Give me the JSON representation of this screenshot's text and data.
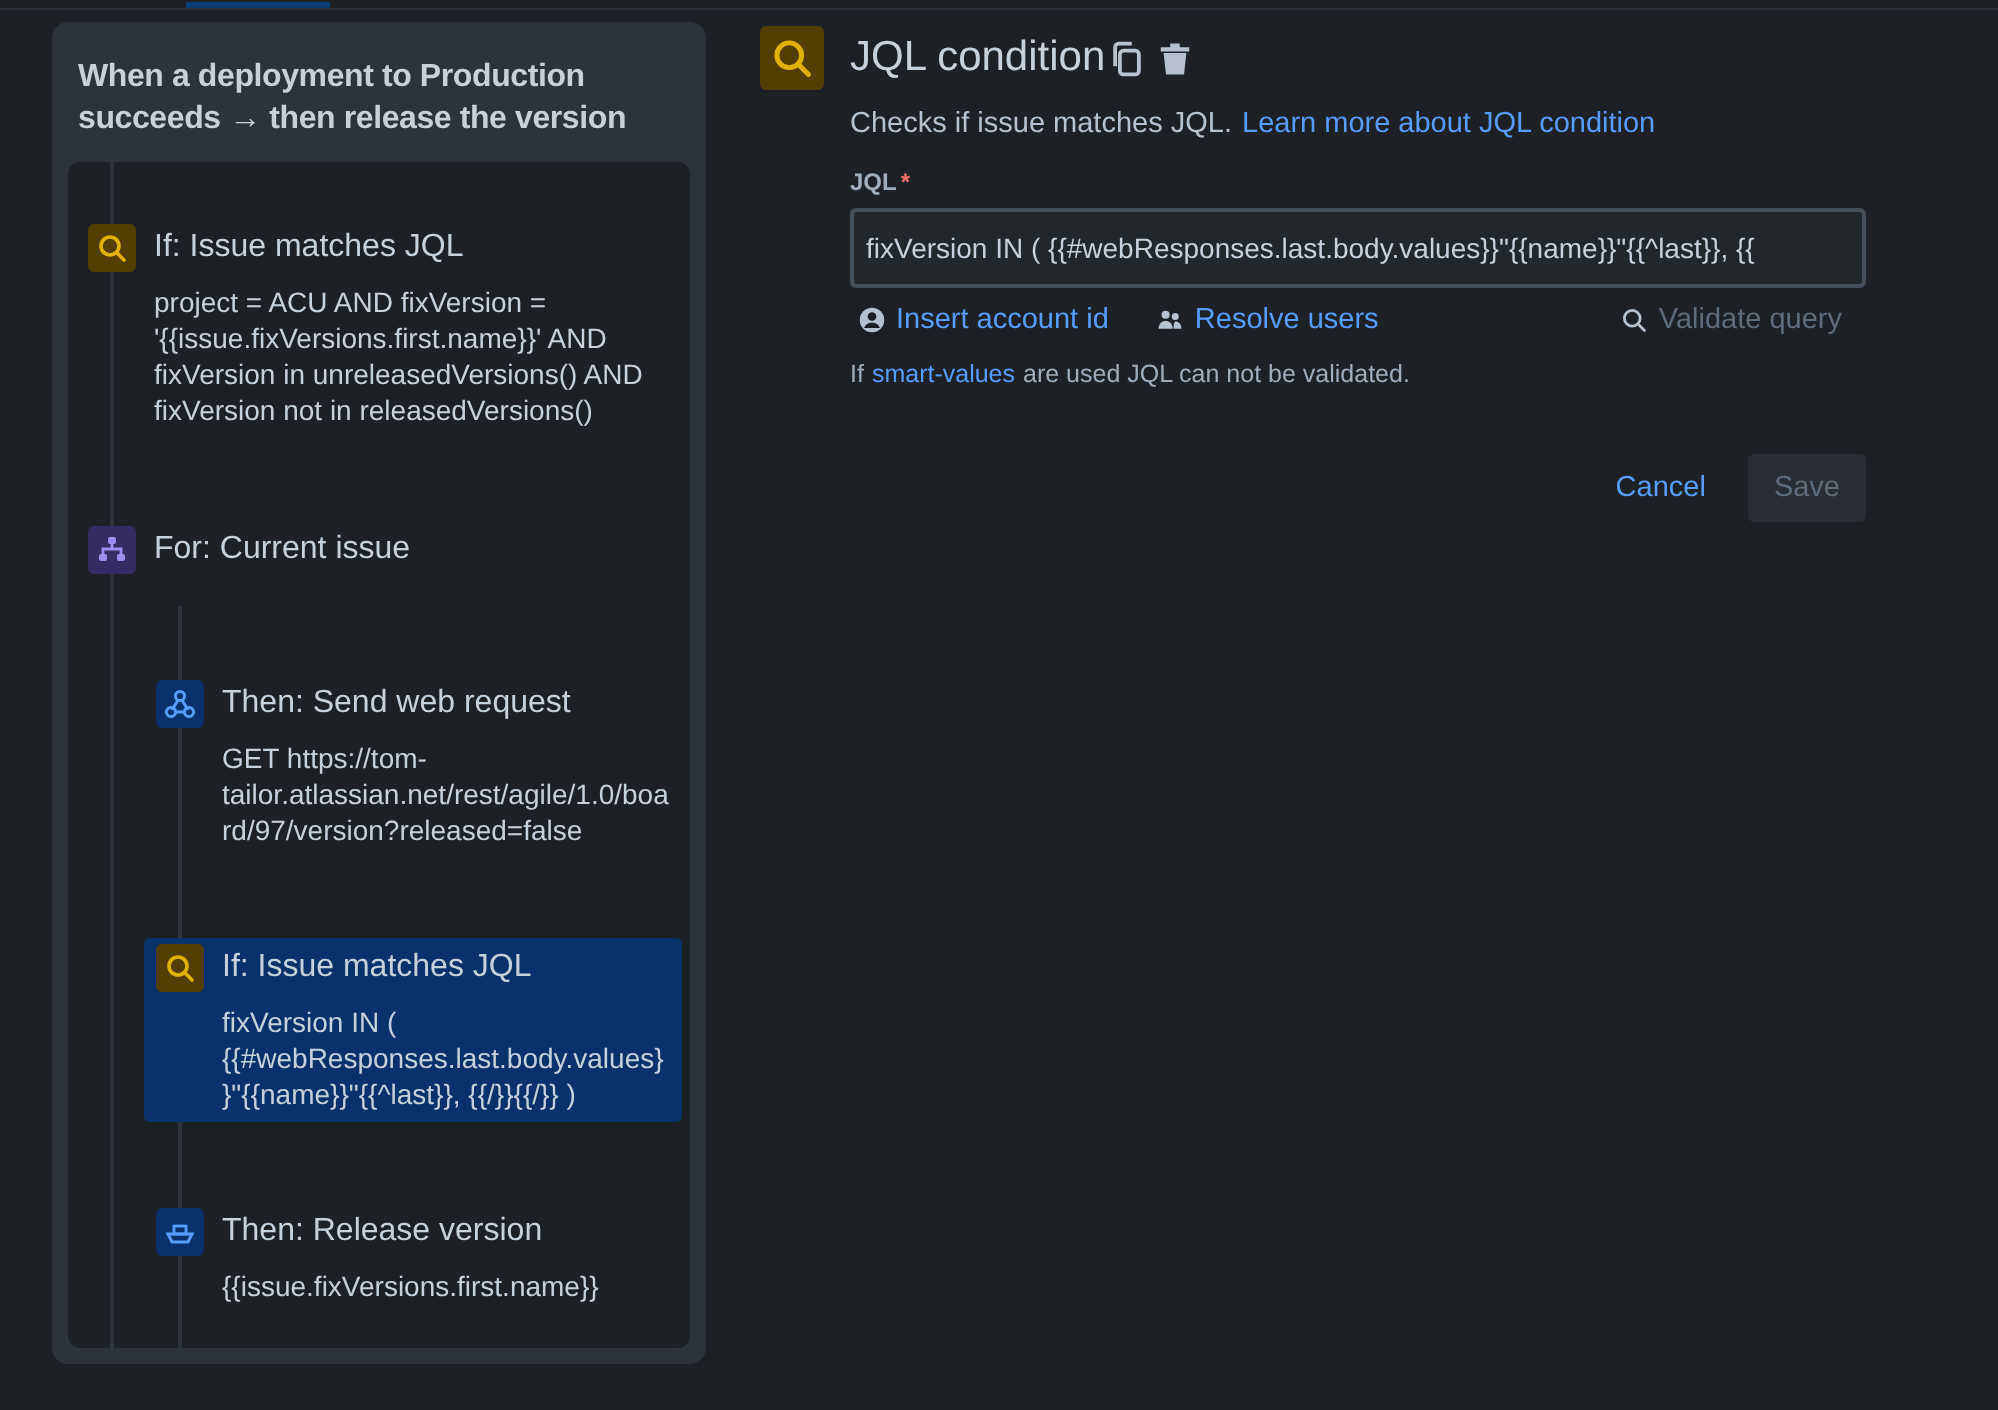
{
  "rule": {
    "title": "When a deployment to Production succeeds → then release the version",
    "steps": [
      {
        "kind": "condition",
        "title": "If: Issue matches JQL",
        "detail": "project = ACU AND fixVersion = '{{issue.fixVersions.first.name}}' AND fixVersion in unreleasedVersions() AND fixVersion not in releasedVersions()",
        "selected": false
      },
      {
        "kind": "branch",
        "title": "For: Current issue",
        "selected": false,
        "children": [
          {
            "kind": "webhook",
            "title": "Then: Send web request",
            "detail": "GET https://tom-tailor.atlassian.net/rest/agile/1.0/board/97/version?released=false",
            "selected": false
          },
          {
            "kind": "condition",
            "title": "If: Issue matches JQL",
            "detail": "fixVersion IN ( {{#webResponses.last.body.values}}\"{{name}}\"{{^last}}, {{/}}{{/}} )",
            "selected": true
          },
          {
            "kind": "release",
            "title": "Then: Release version",
            "detail": "{{issue.fixVersions.first.name}}",
            "selected": false
          }
        ]
      }
    ]
  },
  "editor": {
    "title": "JQL condition",
    "description": "Checks if issue matches JQL.",
    "learn_link": "Learn more about JQL condition",
    "field_label": "JQL",
    "required_mark": "*",
    "value": "fixVersion IN ( {{#webResponses.last.body.values}}\"{{name}}\"{{^last}}, {{",
    "actions": [
      {
        "kind": "account",
        "label": "Insert account id",
        "disabled": false
      },
      {
        "kind": "users",
        "label": "Resolve users",
        "disabled": false
      },
      {
        "kind": "validate",
        "label": "Validate query",
        "disabled": true
      }
    ],
    "note_before": "If",
    "note_link": "smart-values",
    "note_after": "are used JQL can not be validated.",
    "buttons": [
      {
        "label": "Cancel",
        "kind": "subtle",
        "disabled": false
      },
      {
        "label": "Save",
        "kind": "primary",
        "disabled": true
      }
    ]
  }
}
